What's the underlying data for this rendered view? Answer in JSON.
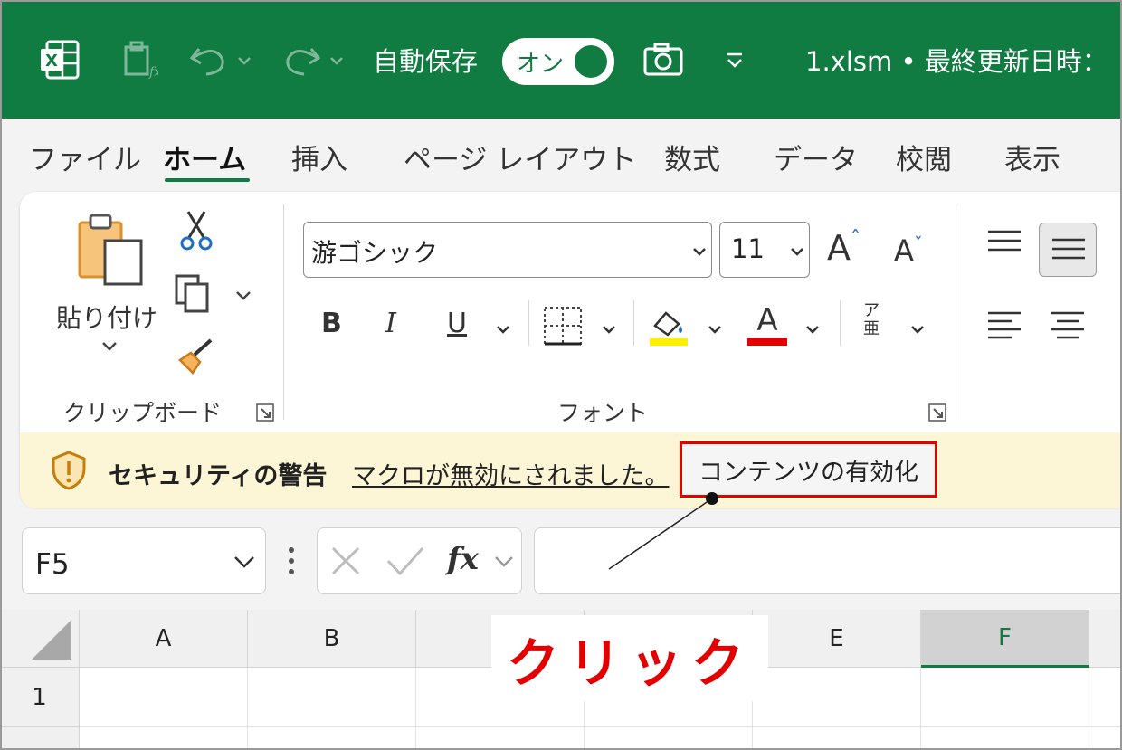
{
  "titlebar": {
    "autosave_label": "自動保存",
    "toggle_label": "オン",
    "filename": "1.xlsm • 最終更新日時："
  },
  "tabs": [
    "ファイル",
    "ホーム",
    "挿入",
    "ページ レイアウト",
    "数式",
    "データ",
    "校閲",
    "表示"
  ],
  "ribbon": {
    "paste_label": "貼り付け",
    "clipboard_group": "クリップボード",
    "font_group": "フォント",
    "font_name": "游ゴシック",
    "font_size": "11",
    "bold": "B",
    "italic": "I",
    "underline": "U",
    "font_color_glyph": "A",
    "phonetic_top": "ア",
    "phonetic_bottom": "亜",
    "grow_font": "A",
    "shrink_font": "A",
    "highlight_color": "#ffee00",
    "font_color": "#e30000"
  },
  "security": {
    "title": "セキュリティの警告",
    "message": "マクロが無効にされました。",
    "button": "コンテンツの有効化"
  },
  "formula_bar": {
    "name_box": "F5",
    "fx": "fx"
  },
  "grid": {
    "columns": [
      "A",
      "B",
      "",
      "",
      "E",
      "F"
    ],
    "rows": [
      "1"
    ]
  },
  "annotation": {
    "text": "クリック",
    "color": "#e30000"
  }
}
